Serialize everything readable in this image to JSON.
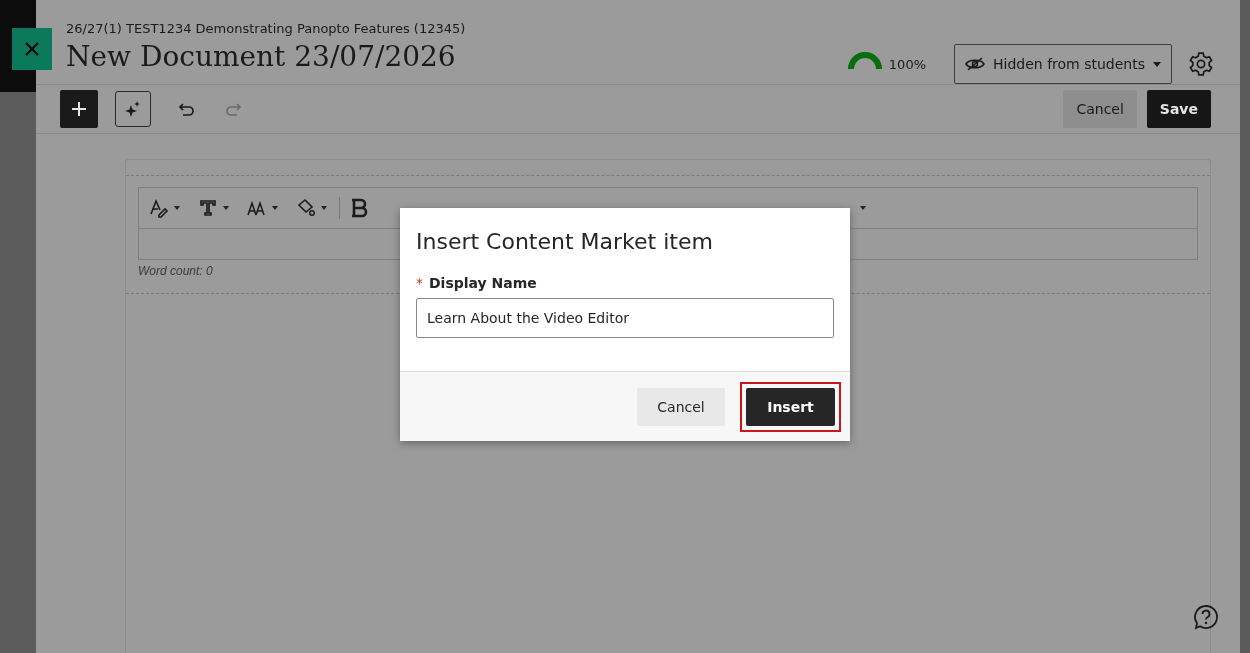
{
  "header": {
    "breadcrumb": "26/27(1) TEST1234 Demonstrating Panopto Features (12345)",
    "title": "New Document 23/07/2026",
    "progress": {
      "level": 1,
      "reading": "100%"
    },
    "visibility": {
      "label": "Hidden from students"
    }
  },
  "toolbar": {
    "tools": [
      {
        "kind": "add"
      },
      {
        "kind": "ai"
      },
      {
        "kind": "undo",
        "disabled": false
      },
      {
        "kind": "redo",
        "disabled": true
      }
    ],
    "buttons": [
      {
        "label": "Cancel",
        "kind": "secondary"
      },
      {
        "label": "Save",
        "kind": "primary"
      }
    ]
  },
  "editor": {
    "format_tools": [
      {
        "kind": "style"
      },
      {
        "kind": "font"
      },
      {
        "kind": "size"
      },
      {
        "kind": "fill"
      },
      {
        "kind": "bold"
      }
    ],
    "word_count": "Word count: 0"
  },
  "dialog": {
    "title": "Insert Content Market item",
    "field": {
      "label": "Display Name",
      "required_mark": "*",
      "value": "Learn About the Video Editor"
    },
    "buttons": [
      {
        "label": "Cancel",
        "kind": "secondary",
        "highlighted": false
      },
      {
        "label": "Insert",
        "kind": "primary",
        "highlighted": true
      }
    ]
  }
}
